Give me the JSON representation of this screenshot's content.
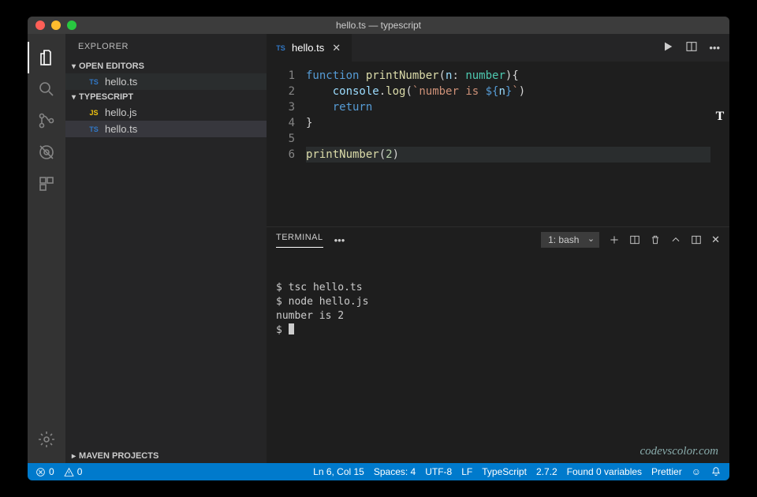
{
  "titlebar": {
    "title": "hello.ts — typescript"
  },
  "sidebar": {
    "title": "EXPLORER",
    "open_editors_label": "OPEN EDITORS",
    "open_editors": [
      {
        "lang": "TS",
        "name": "hello.ts"
      }
    ],
    "workspace_label": "TYPESCRIPT",
    "files": [
      {
        "lang": "JS",
        "name": "hello.js"
      },
      {
        "lang": "TS",
        "name": "hello.ts",
        "active": true
      }
    ],
    "maven_label": "MAVEN PROJECTS"
  },
  "tabs": {
    "active": {
      "lang": "TS",
      "name": "hello.ts"
    }
  },
  "editor": {
    "line_numbers": [
      "1",
      "2",
      "3",
      "4",
      "5",
      "6"
    ],
    "lines": [
      {
        "tokens": [
          [
            "kw",
            "function "
          ],
          [
            "fn",
            "printNumber"
          ],
          [
            "pn",
            "("
          ],
          [
            "pr",
            "n"
          ],
          [
            "pn",
            ": "
          ],
          [
            "ty",
            "number"
          ],
          [
            "pn",
            "){"
          ]
        ]
      },
      {
        "tokens": [
          [
            "pn",
            "    "
          ],
          [
            "pr",
            "console"
          ],
          [
            "pn",
            "."
          ],
          [
            "fn",
            "log"
          ],
          [
            "pn",
            "("
          ],
          [
            "str",
            "`number is "
          ],
          [
            "tpl",
            "${"
          ],
          [
            "pr",
            "n"
          ],
          [
            "tpl",
            "}"
          ],
          [
            "str",
            "`"
          ],
          [
            "pn",
            ")"
          ]
        ]
      },
      {
        "tokens": [
          [
            "pn",
            "    "
          ],
          [
            "kw",
            "return"
          ]
        ]
      },
      {
        "tokens": [
          [
            "pn",
            "}"
          ]
        ]
      },
      {
        "tokens": []
      },
      {
        "tokens": [
          [
            "fn",
            "printNumber"
          ],
          [
            "pn",
            "("
          ],
          [
            "num",
            "2"
          ],
          [
            "pn",
            ")"
          ]
        ],
        "current": true
      }
    ],
    "side_marker": "T"
  },
  "terminal": {
    "tab_label": "TERMINAL",
    "select": "1: bash",
    "lines": [
      "$ tsc hello.ts",
      "$ node hello.js",
      "number is 2",
      "$ "
    ],
    "watermark": "codevscolor.com"
  },
  "statusbar": {
    "errors": "0",
    "warnings": "0",
    "position": "Ln 6, Col 15",
    "spaces": "Spaces: 4",
    "encoding": "UTF-8",
    "eol": "LF",
    "language": "TypeScript",
    "version": "2.7.2",
    "variables": "Found 0 variables",
    "formatter": "Prettier"
  }
}
